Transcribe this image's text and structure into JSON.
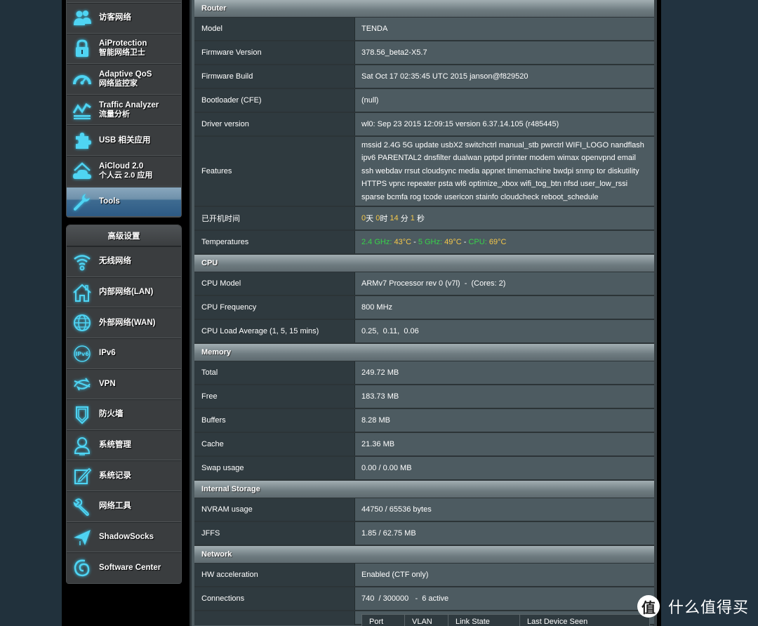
{
  "sidebar": {
    "general_items": [
      {
        "icon": "guest-network-icon",
        "label": "访客网络",
        "sub": ""
      },
      {
        "icon": "lock-icon",
        "label": "AiProtection",
        "sub": "智能网络卫士"
      },
      {
        "icon": "speedometer-icon",
        "label": "Adaptive QoS",
        "sub": "网络监控家"
      },
      {
        "icon": "traffic-chart-icon",
        "label": "Traffic Analyzer",
        "sub": "流量分析"
      },
      {
        "icon": "puzzle-icon",
        "label": "USB 相关应用",
        "sub": ""
      },
      {
        "icon": "cloud-house-icon",
        "label": "AiCloud 2.0",
        "sub": "个人云 2.0 应用"
      },
      {
        "icon": "wrench-icon",
        "label": "Tools",
        "sub": "",
        "active": true
      }
    ],
    "advanced_header": "高级设置",
    "advanced_items": [
      {
        "icon": "wifi-icon",
        "label": "无线网络"
      },
      {
        "icon": "house-icon",
        "label": "内部网络(LAN)"
      },
      {
        "icon": "globe-icon",
        "label": "外部网络(WAN)"
      },
      {
        "icon": "ipv6-icon",
        "label": "IPv6"
      },
      {
        "icon": "vpn-icon",
        "label": "VPN"
      },
      {
        "icon": "shield-icon",
        "label": "防火墙"
      },
      {
        "icon": "user-admin-icon",
        "label": "系统管理"
      },
      {
        "icon": "edit-log-icon",
        "label": "系统记录"
      },
      {
        "icon": "network-tools-icon",
        "label": "网络工具"
      },
      {
        "icon": "paper-plane-icon",
        "label": "ShadowSocks"
      },
      {
        "icon": "swirl-icon",
        "label": "Software Center"
      }
    ]
  },
  "router": {
    "title": "Router",
    "model_label": "Model",
    "model": "TENDA",
    "fw_version_label": "Firmware Version",
    "fw_version": "378.56_beta2-X5.7",
    "fw_build_label": "Firmware Build",
    "fw_build": "Sat Oct 17 02:35:45 UTC 2015 janson@f829520",
    "bootloader_label": "Bootloader (CFE)",
    "bootloader": "(null)",
    "driver_label": "Driver version",
    "driver": "wl0: Sep 23 2015 12:09:15 version 6.37.14.105 (r485445)",
    "features_label": "Features",
    "features": "mssid 2.4G 5G update usbX2 switchctrl manual_stb pwrctrl WIFI_LOGO nandflash ipv6 PARENTAL2 dnsfilter dualwan pptpd printer modem wimax openvpnd email ssh webdav rrsut cloudsync media appnet timemachine bwdpi snmp tor diskutility HTTPS vpnc repeater psta wl6 optimize_xbox wifi_tog_btn nfsd user_low_rssi sparse bcmfa rog tcode usericon stainfo cloudcheck reboot_schedule",
    "uptime_label": "已开机时间",
    "uptime": {
      "days": "0",
      "days_unit": "天",
      "hours": "0",
      "hours_unit": "时",
      "minutes": "14",
      "minutes_unit": "分",
      "seconds": "1",
      "seconds_unit": "秒"
    },
    "temps_label": "Temperatures",
    "temps": {
      "g24_label": "2.4 GHz:",
      "g24": "43°C",
      "g5_label": "5 GHz:",
      "g5": "49°C",
      "cpu_label": "CPU:",
      "cpu": "69°C",
      "sep": " - "
    }
  },
  "cpu": {
    "title": "CPU",
    "model_label": "CPU Model",
    "model": "ARMv7 Processor rev 0 (v7l)  -  (Cores: 2)",
    "freq_label": "CPU Frequency",
    "freq": "800 MHz",
    "load_label": "CPU Load Average (1, 5, 15 mins)",
    "load": "0.25,  0.11,  0.06"
  },
  "memory": {
    "title": "Memory",
    "total_label": "Total",
    "total": "249.72 MB",
    "free_label": "Free",
    "free": "183.73 MB",
    "buffers_label": "Buffers",
    "buffers": "8.28 MB",
    "cache_label": "Cache",
    "cache": "21.36 MB",
    "swap_label": "Swap usage",
    "swap": "0.00 / 0.00 MB"
  },
  "storage": {
    "title": "Internal Storage",
    "nvram_label": "NVRAM usage",
    "nvram": "44750 / 65536 bytes",
    "jffs_label": "JFFS",
    "jffs": "1.85 / 62.75 MB"
  },
  "network": {
    "title": "Network",
    "hw_label": "HW acceleration",
    "hw": "Enabled (CTF only)",
    "conn_label": "Connections",
    "conn": "740  / 300000   -  6 active",
    "port_headers": [
      "Port",
      "VLAN",
      "Link State",
      "Last Device Seen"
    ]
  },
  "watermark": {
    "badge": "值",
    "text": "什么值得买"
  },
  "colors": {
    "highlight": "#f5c84a",
    "green": "#38d24a",
    "icon_glow": "#35c3e8"
  }
}
